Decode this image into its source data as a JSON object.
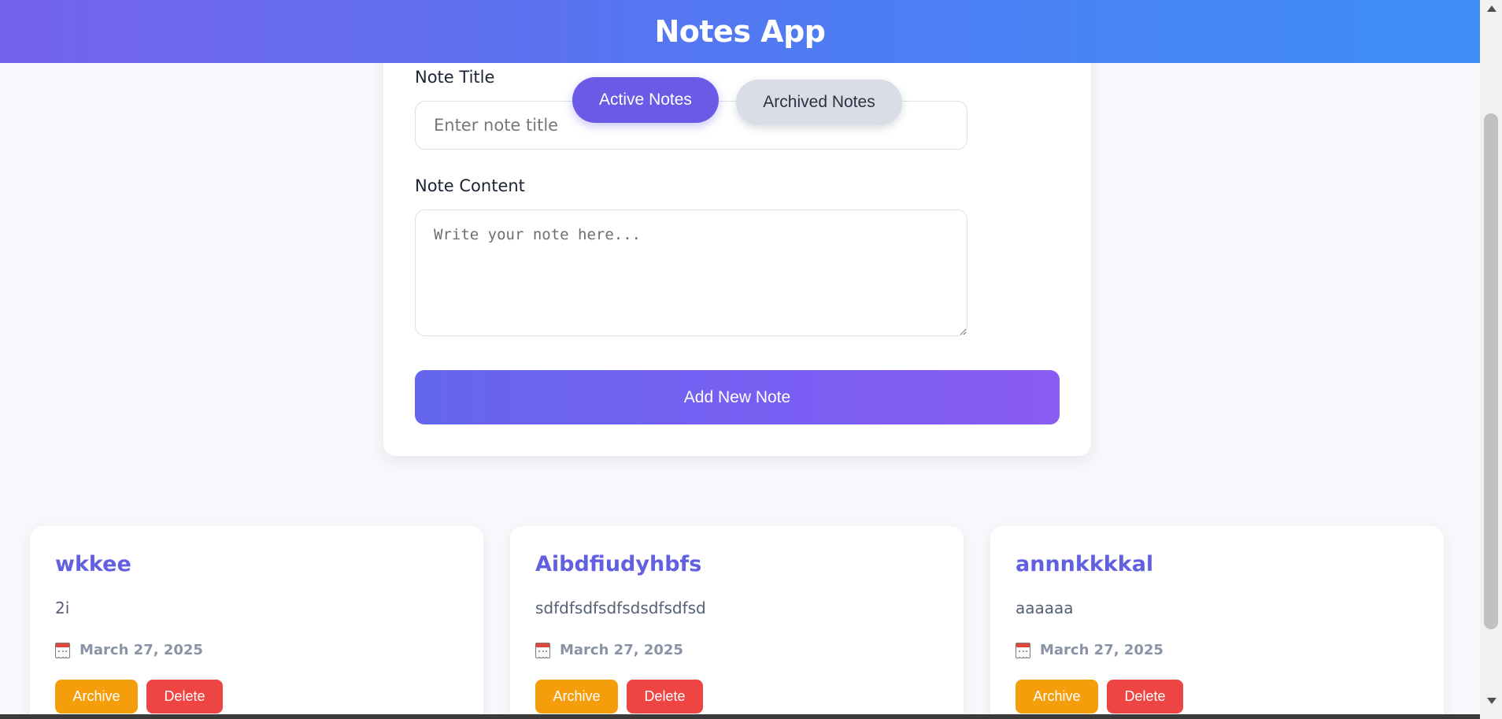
{
  "header": {
    "title": "Notes App"
  },
  "tabs": {
    "active": "Active Notes",
    "archived": "Archived Notes"
  },
  "form": {
    "title_label": "Note Title",
    "title_placeholder": "Enter note title",
    "content_label": "Note Content",
    "content_placeholder": "Write your note here...",
    "submit_label": "Add New Note"
  },
  "notes": [
    {
      "title": "wkkee",
      "body": "2i",
      "date": "March 27, 2025",
      "archive_label": "Archive",
      "delete_label": "Delete"
    },
    {
      "title": "Aibdfiudyhbfs",
      "body": "sdfdfsdfsdfsdsdfsdfsd",
      "date": "March 27, 2025",
      "archive_label": "Archive",
      "delete_label": "Delete"
    },
    {
      "title": "annnkkkkal",
      "body": "aaaaaa",
      "date": "March 27, 2025",
      "archive_label": "Archive",
      "delete_label": "Delete"
    }
  ],
  "icons": {
    "date": "calendar-icon"
  },
  "colors": {
    "accent": "#6a5ae6",
    "archive": "#f59e0b",
    "delete": "#ef4444",
    "note_title": "#6060e0"
  }
}
